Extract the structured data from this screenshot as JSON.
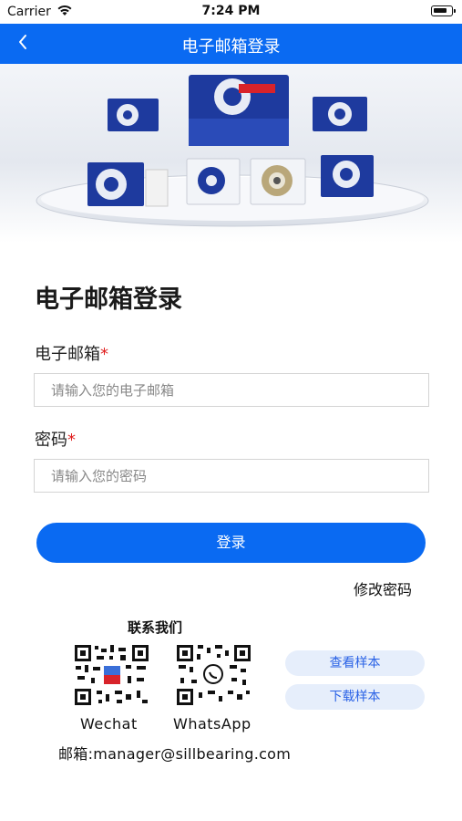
{
  "status_bar": {
    "carrier": "Carrier",
    "time": "7:24 PM"
  },
  "nav": {
    "title": "电子邮箱登录",
    "back_icon": "chevron-left-icon"
  },
  "form": {
    "title": "电子邮箱登录",
    "email_label": "电子邮箱",
    "email_placeholder": "请输入您的电子邮箱",
    "password_label": "密码",
    "password_placeholder": "请输入您的密码",
    "required_mark": "*",
    "login_button": "登录",
    "change_password": "修改密码"
  },
  "contact": {
    "title": "联系我们",
    "qr_codes": [
      {
        "label": "Wechat",
        "icon": "wechat-qr-icon"
      },
      {
        "label": "WhatsApp",
        "icon": "whatsapp-qr-icon"
      }
    ],
    "view_sample": "查看样本",
    "download_sample": "下载样本",
    "email": "邮箱:manager@sillbearing.com"
  },
  "colors": {
    "primary": "#0a6af2",
    "required": "#e02020",
    "pill_bg": "#e6eefb",
    "pill_text": "#2a62e6"
  }
}
